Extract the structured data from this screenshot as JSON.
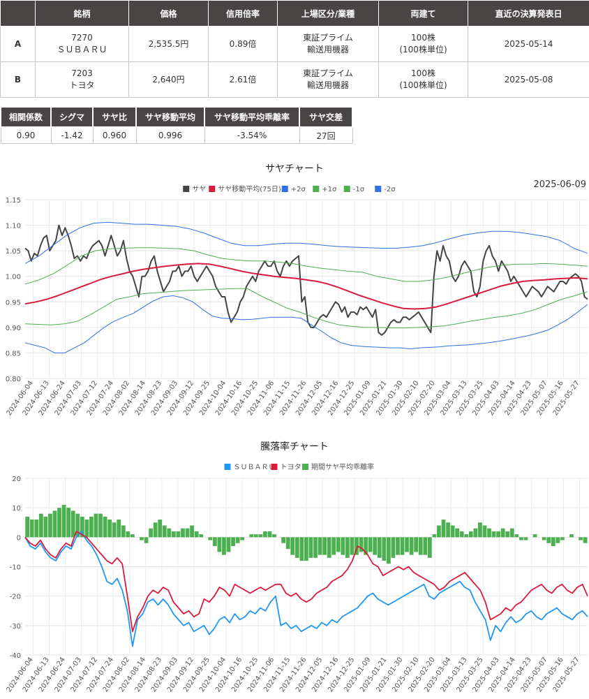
{
  "main_table": {
    "headers": [
      "銘柄",
      "価格",
      "信用倍率",
      "上場区分/業種",
      "両建て",
      "直近の決算発表日"
    ],
    "rows": [
      {
        "label": "A",
        "code": "7270",
        "name": "ＳＵＢＡＲＵ",
        "price": "2,535.5円",
        "margin": "0.89倍",
        "market": "東証プライム",
        "industry": "輸送用機器",
        "lot": "100株",
        "lot_unit": "(100株単位)",
        "date": "2025-05-14"
      },
      {
        "label": "B",
        "code": "7203",
        "name": "トヨタ",
        "price": "2,640円",
        "margin": "2.61倍",
        "market": "東証プライム",
        "industry": "輸送用機器",
        "lot": "100株",
        "lot_unit": "(100株単位)",
        "date": "2025-05-08"
      }
    ]
  },
  "stats": {
    "headers": [
      "相関係数",
      "シグマ",
      "サヤ比",
      "サヤ移動平均",
      "サヤ移動平均乖離率",
      "サヤ交差"
    ],
    "values": [
      "0.90",
      "-1.42",
      "0.960",
      "0.996",
      "-3.54%",
      "27回"
    ]
  },
  "chart_data": [
    {
      "type": "line",
      "title": "サヤチャート",
      "date_label": "2025-06-09",
      "ylim": [
        0.8,
        1.15
      ],
      "yticks": [
        "1.15",
        "1.10",
        "1.05",
        "1.00",
        "0.95",
        "0.90",
        "0.85",
        "0.80"
      ],
      "x_tick_labels": [
        "2024-06-04",
        "2024-06-13",
        "2024-06-24",
        "2024-07-03",
        "2024-07-12",
        "2024-07-24",
        "2024-08-02",
        "2024-08-14",
        "2024-08-23",
        "2024-09-03",
        "2024-09-12",
        "2024-09-25",
        "2024-10-04",
        "2024-10-16",
        "2024-10-25",
        "2024-11-06",
        "2024-11-15",
        "2024-11-26",
        "2024-12-05",
        "2024-12-16",
        "2024-12-25",
        "2025-01-09",
        "2025-01-21",
        "2025-01-30",
        "2025-02-10",
        "2025-02-20",
        "2025-03-04",
        "2025-03-13",
        "2025-03-25",
        "2025-04-03",
        "2025-04-14",
        "2025-04-23",
        "2025-05-07",
        "2025-05-16",
        "2025-05-27"
      ],
      "series": [
        {
          "name": "サヤ",
          "color": "#444444",
          "values": [
            1.055,
            1.05,
            1.03,
            1.045,
            1.04,
            1.06,
            1.075,
            1.08,
            1.05,
            1.06,
            1.07,
            1.1,
            1.08,
            1.095,
            1.08,
            1.06,
            1.035,
            1.04,
            1.03,
            1.04,
            1.035,
            1.05,
            1.06,
            1.065,
            1.07,
            1.06,
            1.04,
            1.06,
            1.08,
            1.06,
            1.04,
            1.05,
            1.07,
            1.035,
            1.01,
            1.0,
            0.98,
            0.96,
            1.0,
            1.0,
            1.01,
            1.03,
            1.04,
            1.01,
            0.99,
            0.97,
            0.98,
            0.99,
            1.01,
            1.01,
            1.02,
            1.0,
            1.01,
            1.01,
            1.02,
            1.0,
            0.99,
            1.0,
            1.01,
            1.02,
            1.01,
            1.0,
            0.98,
            0.97,
            0.96,
            0.96,
            0.93,
            0.91,
            0.92,
            0.93,
            0.95,
            0.96,
            0.98,
            0.99,
            1.0,
            0.99,
            1.01,
            1.02,
            1.03,
            1.02,
            1.02,
            1.03,
            1.01,
            1.0,
            1.02,
            1.03,
            1.02,
            1.03,
            1.035,
            1.04,
            0.95,
            0.96,
            0.91,
            0.9,
            0.9,
            0.91,
            0.92,
            0.925,
            0.92,
            0.93,
            0.94,
            0.95,
            0.945,
            0.93,
            0.94,
            0.92,
            0.93,
            0.93,
            0.925,
            0.94,
            0.935,
            0.94,
            0.93,
            0.92,
            0.935,
            0.89,
            0.885,
            0.89,
            0.9,
            0.91,
            0.915,
            0.91,
            0.91,
            0.92,
            0.92,
            0.915,
            0.92,
            0.925,
            0.93,
            0.92,
            0.91,
            0.9,
            0.89,
            1.0,
            1.05,
            1.03,
            1.06,
            1.04,
            1.03,
            1.0,
            0.99,
            1.0,
            1.02,
            1.03,
            1.02,
            1.01,
            0.97,
            0.96,
            0.98,
            1.03,
            1.05,
            1.06,
            1.04,
            1.03,
            1.01,
            1.03,
            1.02,
            1.01,
            0.99,
            1.0,
            0.99,
            0.98,
            0.97,
            0.96,
            0.97,
            0.98,
            0.975,
            0.97,
            0.96,
            0.97,
            0.98,
            0.975,
            0.97,
            0.98,
            0.99,
            0.99,
            0.985,
            0.995,
            1.0,
            1.005,
            1.0,
            0.99,
            0.96,
            0.955
          ],
          "min_points_note": ""
        },
        {
          "name": "サヤ移動平均(75日)",
          "color": "#d81b3c",
          "values": [
            0.946,
            0.95,
            0.955,
            0.962,
            0.97,
            0.978,
            0.986,
            0.994,
            1.0,
            1.005,
            1.01,
            1.014,
            1.017,
            1.02,
            1.022,
            1.024,
            1.025,
            1.024,
            1.02,
            1.015,
            1.01,
            1.006,
            1.003,
            1.0,
            0.998,
            0.996,
            0.993,
            0.99,
            0.985,
            0.978,
            0.97,
            0.962,
            0.955,
            0.948,
            0.942,
            0.937,
            0.936,
            0.937,
            0.94,
            0.946,
            0.953,
            0.96,
            0.967,
            0.974,
            0.981,
            0.986,
            0.99,
            0.992,
            0.993,
            0.995,
            0.996,
            0.997,
            0.995
          ]
        },
        {
          "name": "+2σ",
          "color": "#2f6fe8",
          "values": [
            1.025,
            1.04,
            1.06,
            1.08,
            1.095,
            1.104,
            1.106,
            1.104,
            1.102,
            1.102,
            1.1,
            1.098,
            1.093,
            1.085,
            1.075,
            1.065,
            1.06,
            1.06,
            1.063,
            1.065,
            1.065,
            1.063,
            1.06,
            1.058,
            1.057,
            1.056,
            1.055,
            1.055,
            1.057,
            1.06,
            1.066,
            1.074,
            1.081,
            1.085,
            1.088,
            1.088,
            1.086,
            1.082,
            1.078,
            1.07,
            1.055,
            1.045
          ]
        },
        {
          "name": "+1σ",
          "color": "#4caf50",
          "values": [
            0.985,
            0.993,
            1.005,
            1.022,
            1.04,
            1.05,
            1.054,
            1.055,
            1.056,
            1.056,
            1.055,
            1.054,
            1.05,
            1.042,
            1.035,
            1.032,
            1.03,
            1.03,
            1.028,
            1.025,
            1.02,
            1.016,
            1.013,
            1.01,
            1.008,
            1.0,
            0.995,
            0.99,
            0.99,
            0.993,
            0.998,
            1.005,
            1.012,
            1.018,
            1.022,
            1.024,
            1.024,
            1.025,
            1.024,
            1.022,
            1.02
          ]
        },
        {
          "name": "-1σ",
          "color": "#4caf50",
          "values": [
            0.907,
            0.906,
            0.905,
            0.907,
            0.912,
            0.925,
            0.94,
            0.955,
            0.96,
            0.966,
            0.968,
            0.97,
            0.972,
            0.973,
            0.974,
            0.975,
            0.976,
            0.976,
            0.962,
            0.95,
            0.938,
            0.93,
            0.92,
            0.912,
            0.905,
            0.902,
            0.9,
            0.9,
            0.899,
            0.899,
            0.9,
            0.901,
            0.903,
            0.907,
            0.912,
            0.916,
            0.92,
            0.923,
            0.928,
            0.935,
            0.945,
            0.955,
            0.962,
            0.97
          ]
        },
        {
          "name": "-2σ",
          "color": "#2f6fe8",
          "values": [
            0.87,
            0.865,
            0.86,
            0.85,
            0.85,
            0.86,
            0.87,
            0.885,
            0.9,
            0.912,
            0.92,
            0.928,
            0.94,
            0.952,
            0.96,
            0.962,
            0.958,
            0.95,
            0.935,
            0.922,
            0.918,
            0.917,
            0.915,
            0.916,
            0.918,
            0.92,
            0.92,
            0.92,
            0.918,
            0.905,
            0.893,
            0.88,
            0.87,
            0.865,
            0.863,
            0.862,
            0.861,
            0.86,
            0.86,
            0.858,
            0.86,
            0.861,
            0.862,
            0.864,
            0.865,
            0.866,
            0.868,
            0.87,
            0.873,
            0.876,
            0.88,
            0.884,
            0.889,
            0.895,
            0.905,
            0.916,
            0.93,
            0.945
          ]
        }
      ],
      "legend": [
        "サヤ",
        "サヤ移動平均(75日)",
        "+2σ",
        "+1σ",
        "-1σ",
        "-2σ"
      ],
      "legend_colors": [
        "#444444",
        "#d81b3c",
        "#2f6fe8",
        "#4caf50",
        "#4caf50",
        "#2f6fe8"
      ],
      "grid": true,
      "legend_position": "top"
    },
    {
      "type": "line",
      "title": "騰落率チャート",
      "ylim": [
        -40,
        20
      ],
      "yticks": [
        "20",
        "10",
        "0",
        "-10",
        "-20",
        "-30",
        "-40"
      ],
      "x_tick_labels": [
        "2024-06-04",
        "2024-06-13",
        "2024-06-24",
        "2024-07-03",
        "2024-07-12",
        "2024-07-24",
        "2024-08-02",
        "2024-08-14",
        "2024-08-23",
        "2024-09-03",
        "2024-09-12",
        "2024-09-25",
        "2024-10-04",
        "2024-10-16",
        "2024-10-25",
        "2024-11-06",
        "2024-11-15",
        "2024-11-26",
        "2024-12-05",
        "2024-12-16",
        "2024-12-25",
        "2025-01-09",
        "2025-01-21",
        "2025-01-30",
        "2025-02-10",
        "2025-02-20",
        "2025-03-04",
        "2025-03-13",
        "2025-03-25",
        "2025-04-03",
        "2025-04-14",
        "2025-04-23",
        "2025-05-07",
        "2025-05-16",
        "2025-05-27"
      ],
      "series": [
        {
          "name": "ＳＵＢＡＲＵ",
          "color": "#2196f3",
          "values": [
            0,
            -3,
            -4,
            -2,
            -5,
            -7,
            -8,
            -5,
            -3,
            -4,
            0,
            2,
            -1,
            -3,
            -6,
            -10,
            -15,
            -16,
            -14,
            -18,
            -25,
            -37,
            -28,
            -26,
            -22,
            -21,
            -23,
            -21,
            -23,
            -26,
            -28,
            -30,
            -29,
            -32,
            -31,
            -30,
            -33,
            -31,
            -28,
            -27,
            -29,
            -26,
            -28,
            -27,
            -25,
            -26,
            -24,
            -25,
            -22,
            -20,
            -30,
            -29,
            -31,
            -30,
            -32,
            -31,
            -30,
            -31,
            -29,
            -30,
            -28,
            -29,
            -27,
            -26,
            -25,
            -24,
            -22,
            -20,
            -19,
            -21,
            -22,
            -23,
            -22,
            -21,
            -20,
            -19,
            -18,
            -17,
            -16,
            -20,
            -21,
            -19,
            -18,
            -17,
            -16,
            -15,
            -17,
            -18,
            -22,
            -25,
            -28,
            -35,
            -30,
            -32,
            -29,
            -27,
            -29,
            -28,
            -26,
            -25,
            -27,
            -28,
            -26,
            -25,
            -24,
            -26,
            -27,
            -28,
            -26,
            -25,
            -27
          ]
        },
        {
          "name": "トヨタ",
          "color": "#d81b3c",
          "values": [
            0,
            -2,
            -3,
            -1,
            -4,
            -6,
            -7,
            -4,
            -2,
            -3,
            2,
            1,
            0,
            -2,
            -4,
            -6,
            -8,
            -9,
            -7,
            -9,
            -20,
            -32,
            -27,
            -24,
            -20,
            -18,
            -19,
            -17,
            -18,
            -22,
            -24,
            -26,
            -25,
            -27,
            -26,
            -21,
            -22,
            -20,
            -17,
            -18,
            -20,
            -16,
            -17,
            -18,
            -19,
            -18,
            -17,
            -18,
            -17,
            -16,
            -16,
            -19,
            -20,
            -19,
            -21,
            -22,
            -21,
            -19,
            -18,
            -17,
            -15,
            -14,
            -13,
            -11,
            -8,
            -3,
            -4,
            -6,
            -9,
            -10,
            -13,
            -12,
            -11,
            -10,
            -11,
            -10,
            -12,
            -13,
            -14,
            -15,
            -16,
            -18,
            -17,
            -15,
            -14,
            -13,
            -12,
            -14,
            -16,
            -18,
            -22,
            -28,
            -27,
            -26,
            -24,
            -25,
            -23,
            -22,
            -20,
            -18,
            -17,
            -16,
            -18,
            -19,
            -17,
            -16,
            -18,
            -19,
            -17,
            -16,
            -20
          ]
        },
        {
          "name": "期間サヤ平均乖離率",
          "color": "#4caf50",
          "type": "bar",
          "values": [
            7,
            6,
            6,
            8,
            7,
            8,
            9,
            10,
            11,
            10,
            9,
            8,
            7,
            6,
            7,
            8,
            8,
            7,
            6,
            5,
            6,
            4,
            2,
            1,
            0,
            -1,
            -2,
            3,
            5,
            6,
            4,
            3,
            2,
            2,
            3,
            3,
            4,
            2,
            1,
            0,
            -1,
            -3,
            -5,
            -6,
            -5,
            -3,
            -2,
            -1,
            0,
            1,
            1,
            1,
            2,
            2,
            1,
            0,
            -2,
            -4,
            -6,
            -7,
            -8,
            -8,
            -7,
            -7,
            -6,
            -6,
            -7,
            -6,
            -5,
            -6,
            -7,
            -6,
            -6,
            -5,
            -6,
            -5,
            -6,
            -7,
            -8,
            -9,
            -7,
            -6,
            -6,
            -5,
            -6,
            -5,
            -6,
            -6,
            -7,
            1,
            4,
            6,
            5,
            4,
            3,
            2,
            1,
            2,
            3,
            5,
            4,
            3,
            2,
            2,
            3,
            2,
            3,
            1,
            -1,
            -1,
            0,
            1,
            0,
            -1,
            -2,
            -3,
            -2,
            -1,
            0,
            1,
            0,
            -1,
            -2
          ]
        }
      ],
      "legend": [
        "ＳＵＢＡＲＵ",
        "トヨタ",
        "期間サヤ平均乖離率"
      ],
      "legend_colors": [
        "#2196f3",
        "#d81b3c",
        "#4caf50"
      ],
      "grid": true,
      "legend_position": "top"
    }
  ]
}
